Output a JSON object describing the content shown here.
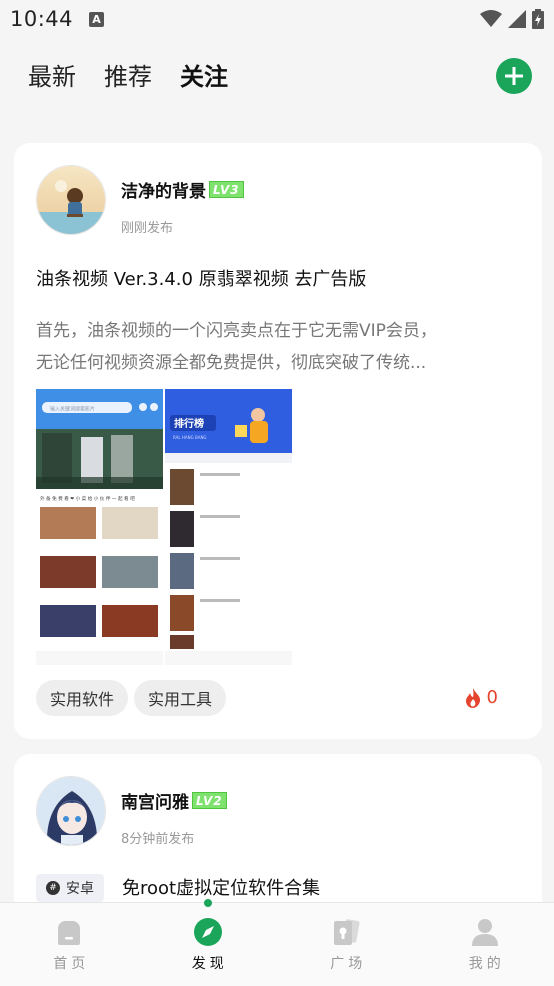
{
  "status_bar": {
    "time": "10:44",
    "notification_badge": "A"
  },
  "top_nav": {
    "tabs": [
      {
        "label": "最新",
        "active": false
      },
      {
        "label": "推荐",
        "active": false
      },
      {
        "label": "关注",
        "active": true
      }
    ],
    "add_icon": "plus-icon"
  },
  "posts": [
    {
      "author": "洁净的背景",
      "level": "LV3",
      "time": "刚刚发布",
      "title": "油条视频 Ver.3.4.0 原翡翠视频 去广告版",
      "body_line1": "首先，油条视频的一个闪亮卖点在于它无需VIP会员，",
      "body_line2": "无论任何视频资源全都免费提供，彻底突破了传统...",
      "image": {
        "left_search": "输入关键词搜索影片",
        "left_banner_text": "外 备 免 费 看 ❤ 小 菜 给 小 伙 伴 一 起 看 吧",
        "right_header": "排行榜",
        "right_subheader": "RAL HANG BANG"
      },
      "tags": [
        "实用软件",
        "实用工具"
      ],
      "hot_count": "0"
    },
    {
      "author": "南宫问雅",
      "level": "LV2",
      "time": "8分钟前发布",
      "platform": "安卓",
      "title": "免root虚拟定位软件合集"
    }
  ],
  "bottom_nav": [
    {
      "label": "首页",
      "icon": "home-icon",
      "active": false
    },
    {
      "label": "发现",
      "icon": "compass-icon",
      "active": true
    },
    {
      "label": "广场",
      "icon": "square-cards-icon",
      "active": false
    },
    {
      "label": "我的",
      "icon": "user-icon",
      "active": false
    }
  ],
  "colors": {
    "accent": "#1aa55a",
    "hot": "#e5452f",
    "level_badge": "#7fe26e"
  }
}
